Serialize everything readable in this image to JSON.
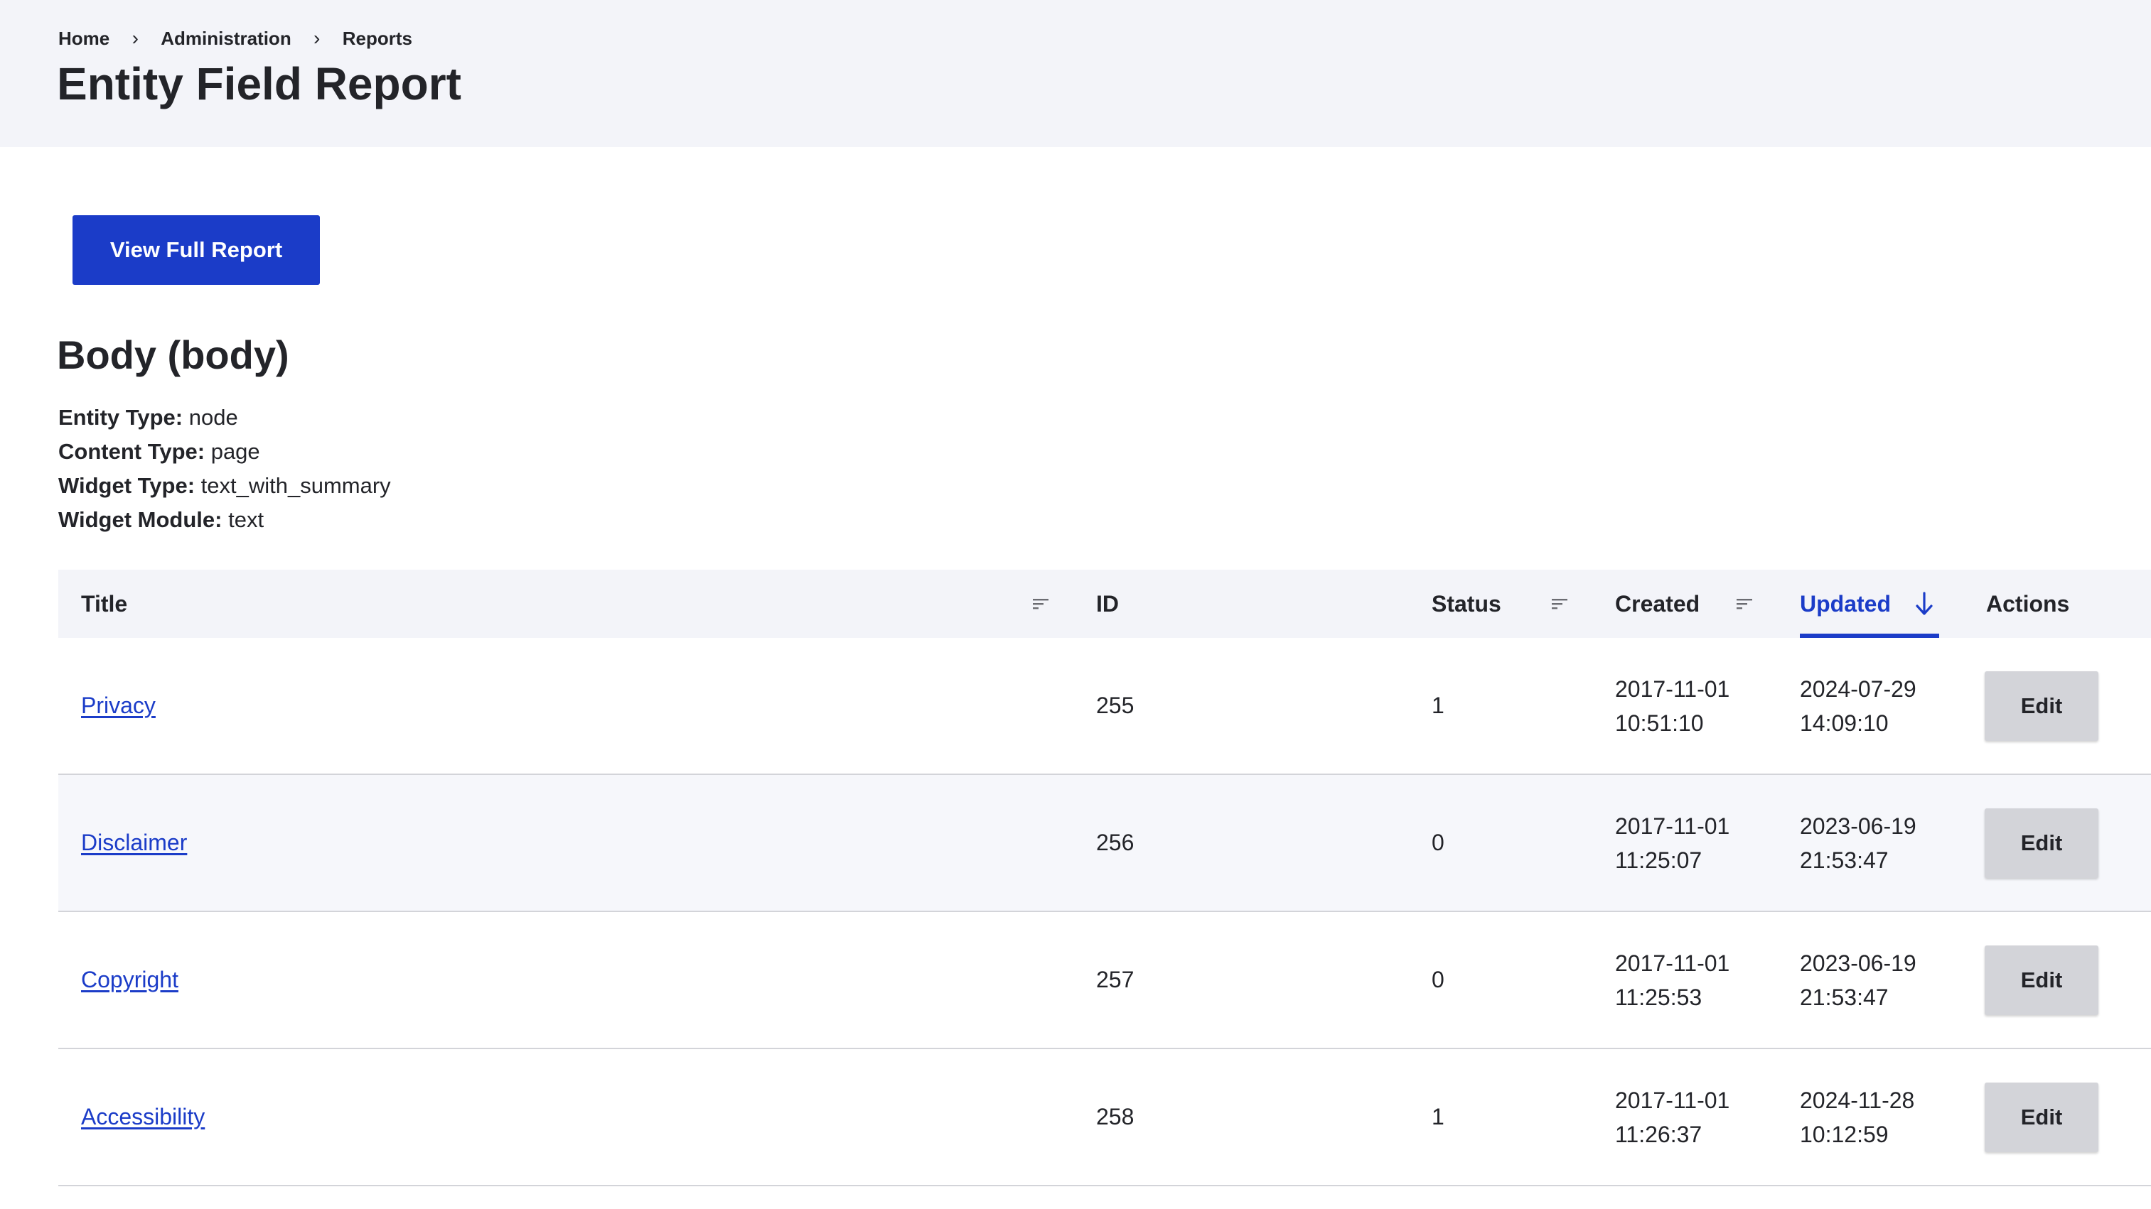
{
  "breadcrumb": {
    "items": [
      "Home",
      "Administration",
      "Reports"
    ],
    "separator": "›"
  },
  "page": {
    "title": "Entity Field Report"
  },
  "actions": {
    "view_full_report": "View Full Report"
  },
  "field": {
    "title": "Body (body)",
    "meta": [
      {
        "label": "Entity Type:",
        "value": "node"
      },
      {
        "label": "Content Type:",
        "value": "page"
      },
      {
        "label": "Widget Type:",
        "value": "text_with_summary"
      },
      {
        "label": "Widget Module:",
        "value": "text"
      }
    ]
  },
  "table": {
    "headers": {
      "title": "Title",
      "id": "ID",
      "status": "Status",
      "created": "Created",
      "updated": "Updated",
      "actions": "Actions"
    },
    "sorted_by": "updated",
    "sort_direction": "desc",
    "accent_color": "#1b3cc8",
    "rows": [
      {
        "title": "Privacy",
        "id": "255",
        "status": "1",
        "created_date": "2017-11-01",
        "created_time": "10:51:10",
        "updated_date": "2024-07-29",
        "updated_time": "14:09:10",
        "action": "Edit"
      },
      {
        "title": "Disclaimer",
        "id": "256",
        "status": "0",
        "created_date": "2017-11-01",
        "created_time": "11:25:07",
        "updated_date": "2023-06-19",
        "updated_time": "21:53:47",
        "action": "Edit"
      },
      {
        "title": "Copyright",
        "id": "257",
        "status": "0",
        "created_date": "2017-11-01",
        "created_time": "11:25:53",
        "updated_date": "2023-06-19",
        "updated_time": "21:53:47",
        "action": "Edit"
      },
      {
        "title": "Accessibility",
        "id": "258",
        "status": "1",
        "created_date": "2017-11-01",
        "created_time": "11:26:37",
        "updated_date": "2024-11-28",
        "updated_time": "10:12:59",
        "action": "Edit"
      }
    ]
  }
}
